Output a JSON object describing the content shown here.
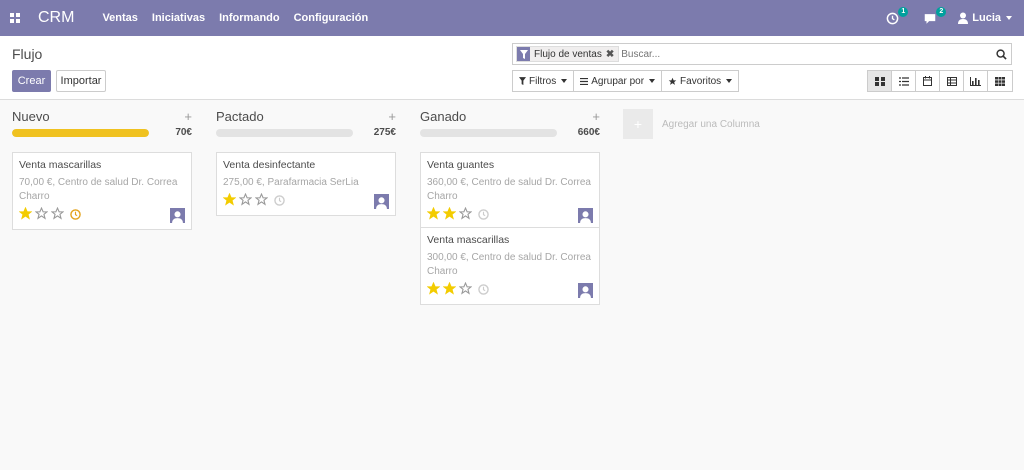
{
  "navbar": {
    "brand": "CRM",
    "menu": [
      "Ventas",
      "Iniciativas",
      "Informando",
      "Configuración"
    ],
    "activity_count": "1",
    "messages_count": "2",
    "user_name": "Lucia"
  },
  "control": {
    "title": "Flujo",
    "create_label": "Crear",
    "import_label": "Importar",
    "search": {
      "facet_label": "Flujo de ventas",
      "placeholder": "Buscar..."
    },
    "filters_label": "Filtros",
    "groupby_label": "Agrupar por",
    "favorites_label": "Favoritos",
    "views": [
      "kanban",
      "list",
      "calendar",
      "pivot",
      "graph",
      "dashboard"
    ],
    "active_view": "kanban"
  },
  "columns": [
    {
      "title": "Nuevo",
      "total": "70€",
      "progress": 1.0,
      "cards": [
        {
          "title": "Venta mascarillas",
          "line1": "70,00 €, Centro de salud Dr. Correa",
          "line2": "Charro",
          "stars": 1,
          "activity": "warning"
        }
      ]
    },
    {
      "title": "Pactado",
      "total": "275€",
      "progress": 0,
      "cards": [
        {
          "title": "Venta desinfectante",
          "line1": "275,00 €, Parafarmacia SerLia",
          "line2": "",
          "stars": 1,
          "activity": "none"
        }
      ]
    },
    {
      "title": "Ganado",
      "total": "660€",
      "progress": 0,
      "cards": [
        {
          "title": "Venta guantes",
          "line1": "360,00 €, Centro de salud Dr. Correa",
          "line2": "Charro",
          "stars": 2,
          "activity": "none"
        },
        {
          "title": "Venta mascarillas",
          "line1": "300,00 €, Centro de salud Dr. Correa",
          "line2": "Charro",
          "stars": 2,
          "activity": "none"
        }
      ]
    }
  ],
  "add_column_label": "Agregar una Columna",
  "colors": {
    "primary": "#7c7bad",
    "progress_fill": "#f0c220",
    "star": "#f3cc00",
    "badge": "#00a09d"
  }
}
